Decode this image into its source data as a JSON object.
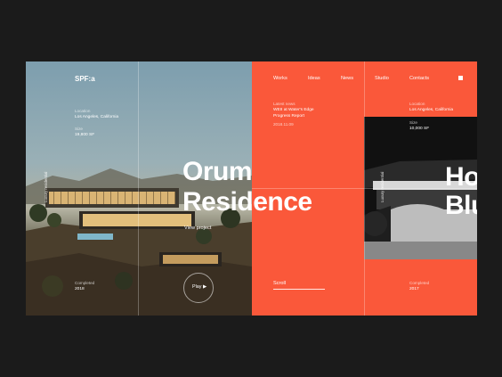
{
  "brand": {
    "logo": "SPF:a"
  },
  "nav": {
    "items": [
      "Works",
      "Ideas",
      "News",
      "Studio",
      "Contacts"
    ]
  },
  "project": {
    "location_label": "Location",
    "location_value": "Los Angeles, California",
    "size_label": "Size",
    "size_value": "19,800 SF",
    "title_line1": "Orum",
    "title_line2": "Residence",
    "view_link": "View project",
    "completed_label": "Completed",
    "completed_value": "2018",
    "play_label": "Play ▶",
    "vertical_tag": "Luxury residential"
  },
  "news": {
    "label": "Latest news",
    "headline_line1": "WEII at Water's Edge",
    "headline_line2": "Progress Report",
    "date": "2018.11.09",
    "scroll_label": "Scroll"
  },
  "next_project": {
    "location_label": "Location",
    "location_value": "Los Angeles, California",
    "size_label": "Size",
    "size_value": "10,000 SF",
    "title_line1": "Ho",
    "title_line2": "Blu",
    "completed_label": "Completed",
    "completed_value": "2017",
    "vertical_tag": "Luxury residential"
  },
  "colors": {
    "accent": "#fa583a",
    "background": "#1b1b1b"
  }
}
